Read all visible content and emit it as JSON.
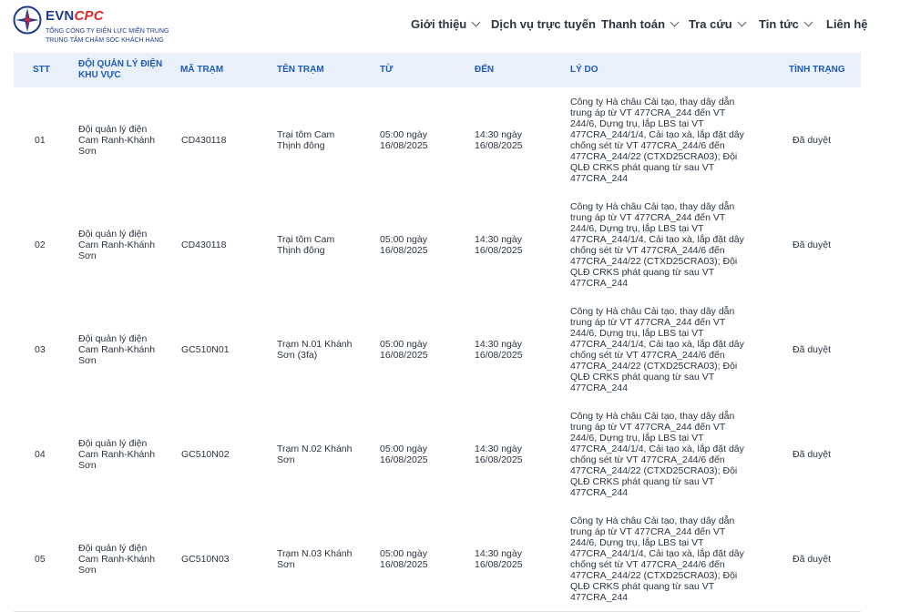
{
  "header": {
    "brand_evn": "EVN",
    "brand_cpc": "CPC",
    "brand_line1": "TỔNG CÔNG TY ĐIỆN LỰC MIỀN TRUNG",
    "brand_line2": "TRUNG TÂM CHĂM SÓC KHÁCH HÀNG",
    "nav": [
      {
        "label": "Giới thiệu",
        "has_dropdown": true
      },
      {
        "label": "Dịch vụ trực tuyến",
        "has_dropdown": false
      },
      {
        "label": "Thanh toán",
        "has_dropdown": true
      },
      {
        "label": "Tra cứu",
        "has_dropdown": true
      },
      {
        "label": "Tin tức",
        "has_dropdown": true
      },
      {
        "label": "Liên hệ",
        "has_dropdown": false
      }
    ]
  },
  "table": {
    "columns": [
      "STT",
      "ĐỘI QUẢN LÝ ĐIỆN KHU VỰC",
      "MÃ TRẠM",
      "TÊN TRẠM",
      "TỪ",
      "ĐẾN",
      "LÝ DO",
      "TÌNH TRẠNG"
    ],
    "rows": [
      {
        "stt": "01",
        "doi": "Đội quản lý điện\nCam Ranh-Khánh\nSơn",
        "ma": "CD430118",
        "ten": "Trại tôm Cam\nThịnh đông",
        "tu": "05:00 ngày\n16/08/2025",
        "den": "14:30 ngày\n16/08/2025",
        "lydo": "Công ty Hà châu Cải tạo, thay dây dẫn\ntrung áp từ VT 477CRA_244 đến VT\n244/6, Dựng trụ, lắp LBS tại VT\n477CRA_244/1/4, Cải tạo xà, lắp đặt dây\nchống sét từ VT 477CRA_244/6 đến\n477CRA_244/22 (CTXD25CRA03); Đội\nQLĐ CRKS phát quang từ sau VT\n477CRA_244",
        "tinhtrang": "Đã duyệt"
      },
      {
        "stt": "02",
        "doi": "Đội quản lý điện\nCam Ranh-Khánh\nSơn",
        "ma": "CD430118",
        "ten": "Trại tôm Cam\nThịnh đông",
        "tu": "05:00 ngày\n16/08/2025",
        "den": "14:30 ngày\n16/08/2025",
        "lydo": "Công ty Hà châu Cải tạo, thay dây dẫn\ntrung áp từ VT 477CRA_244 đến VT\n244/6, Dựng trụ, lắp LBS tại VT\n477CRA_244/1/4, Cải tạo xà, lắp đặt dây\nchống sét từ VT 477CRA_244/6 đến\n477CRA_244/22 (CTXD25CRA03); Đội\nQLĐ CRKS phát quang từ sau VT\n477CRA_244",
        "tinhtrang": "Đã duyệt"
      },
      {
        "stt": "03",
        "doi": "Đội quản lý điện\nCam Ranh-Khánh\nSơn",
        "ma": "GC510N01",
        "ten": "Trạm N.01 Khánh\nSơn (3fa)",
        "tu": "05:00 ngày\n16/08/2025",
        "den": "14:30 ngày\n16/08/2025",
        "lydo": "Công ty Hà châu Cải tạo, thay dây dẫn\ntrung áp từ VT 477CRA_244 đến VT\n244/6, Dựng trụ, lắp LBS tại VT\n477CRA_244/1/4, Cải tạo xà, lắp đặt dây\nchống sét từ VT 477CRA_244/6 đến\n477CRA_244/22 (CTXD25CRA03); Đội\nQLĐ CRKS phát quang từ sau VT\n477CRA_244",
        "tinhtrang": "Đã duyệt"
      },
      {
        "stt": "04",
        "doi": "Đội quản lý điện\nCam Ranh-Khánh\nSơn",
        "ma": "GC510N02",
        "ten": "Trạm N.02 Khánh\nSơn",
        "tu": "05:00 ngày\n16/08/2025",
        "den": "14:30 ngày\n16/08/2025",
        "lydo": "Công ty Hà châu Cải tạo, thay dây dẫn\ntrung áp từ VT 477CRA_244 đến VT\n244/6, Dựng trụ, lắp LBS tại VT\n477CRA_244/1/4, Cải tạo xà, lắp đặt dây\nchống sét từ VT 477CRA_244/6 đến\n477CRA_244/22 (CTXD25CRA03); Đội\nQLĐ CRKS phát quang từ sau VT\n477CRA_244",
        "tinhtrang": "Đã duyệt"
      },
      {
        "stt": "05",
        "doi": "Đội quản lý điện\nCam Ranh-Khánh\nSơn",
        "ma": "GC510N03",
        "ten": "Trạm N.03 Khánh\nSơn",
        "tu": "05:00 ngày\n16/08/2025",
        "den": "14:30 ngày\n16/08/2025",
        "lydo": "Công ty Hà châu Cải tạo, thay dây dẫn\ntrung áp từ VT 477CRA_244 đến VT\n244/6, Dựng trụ, lắp LBS tại VT\n477CRA_244/1/4, Cải tạo xà, lắp đặt dây\nchống sét từ VT 477CRA_244/6 đến\n477CRA_244/22 (CTXD25CRA03); Đội\nQLĐ CRKS phát quang từ sau VT\n477CRA_244",
        "tinhtrang": "Đã duyệt"
      }
    ]
  }
}
